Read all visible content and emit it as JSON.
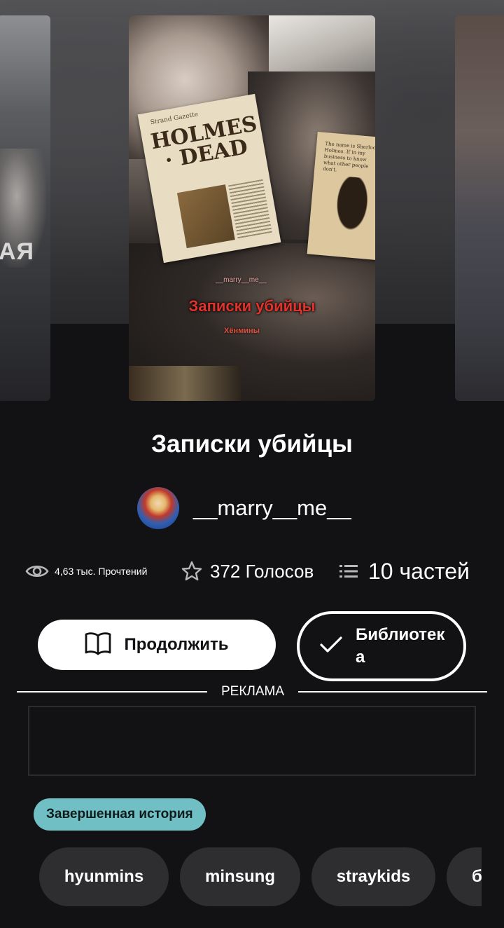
{
  "cover": {
    "newspaper_top": "Strand Gazette",
    "newspaper_headline": "HOLMES · DEAD",
    "note_text": "The name is Sherlock Holmes. If in my business to know what other people don't.",
    "side_letters": "АЯ",
    "handle": "__marry__me__",
    "title": "Записки убийцы",
    "subtitle": "Хёнмины"
  },
  "book": {
    "title": "Записки убийцы",
    "author": "__marry__me__"
  },
  "stats": {
    "reads": "4,63 тыс. Прочтений",
    "votes": "372 Голосов",
    "parts": "10 частей"
  },
  "actions": {
    "continue_label": "Продолжить",
    "library_label": "Библиотека"
  },
  "ad": {
    "label": "РЕКЛАМА"
  },
  "status_badge": "Завершенная история",
  "tags": [
    "hyunmins",
    "minsung",
    "straykids",
    "б"
  ],
  "colors": {
    "background": "#121113",
    "badge": "#6fbfc4",
    "tag_bg": "#2e2d30",
    "cover_title": "#e1322b"
  },
  "icons": {
    "reads": "eye-icon",
    "votes": "star-icon",
    "parts": "list-icon",
    "continue": "book-open-icon",
    "library": "check-icon"
  }
}
